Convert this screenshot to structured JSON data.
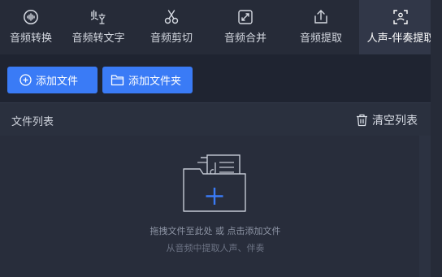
{
  "toolbar": {
    "items": [
      {
        "label": "音频转换",
        "icon": "audio-convert-icon"
      },
      {
        "label": "音频转文字",
        "icon": "speech-to-text-icon"
      },
      {
        "label": "音频剪切",
        "icon": "scissors-icon"
      },
      {
        "label": "音频合并",
        "icon": "merge-icon"
      },
      {
        "label": "音频提取",
        "icon": "extract-icon"
      },
      {
        "label": "人声-伴奏提取",
        "icon": "voice-separate-icon"
      }
    ],
    "active_index": 5
  },
  "actions": {
    "add_file_label": "添加文件",
    "add_folder_label": "添加文件夹"
  },
  "file_list": {
    "title": "文件列表",
    "clear_label": "清空列表",
    "empty_hint": "拖拽文件至此处 或 点击添加文件",
    "empty_subhint": "从音频中提取人声、伴奏"
  },
  "colors": {
    "accent": "#3a7bf6",
    "background": "#1f2431",
    "toolbar": "#262b38",
    "active_tab": "#313748"
  }
}
